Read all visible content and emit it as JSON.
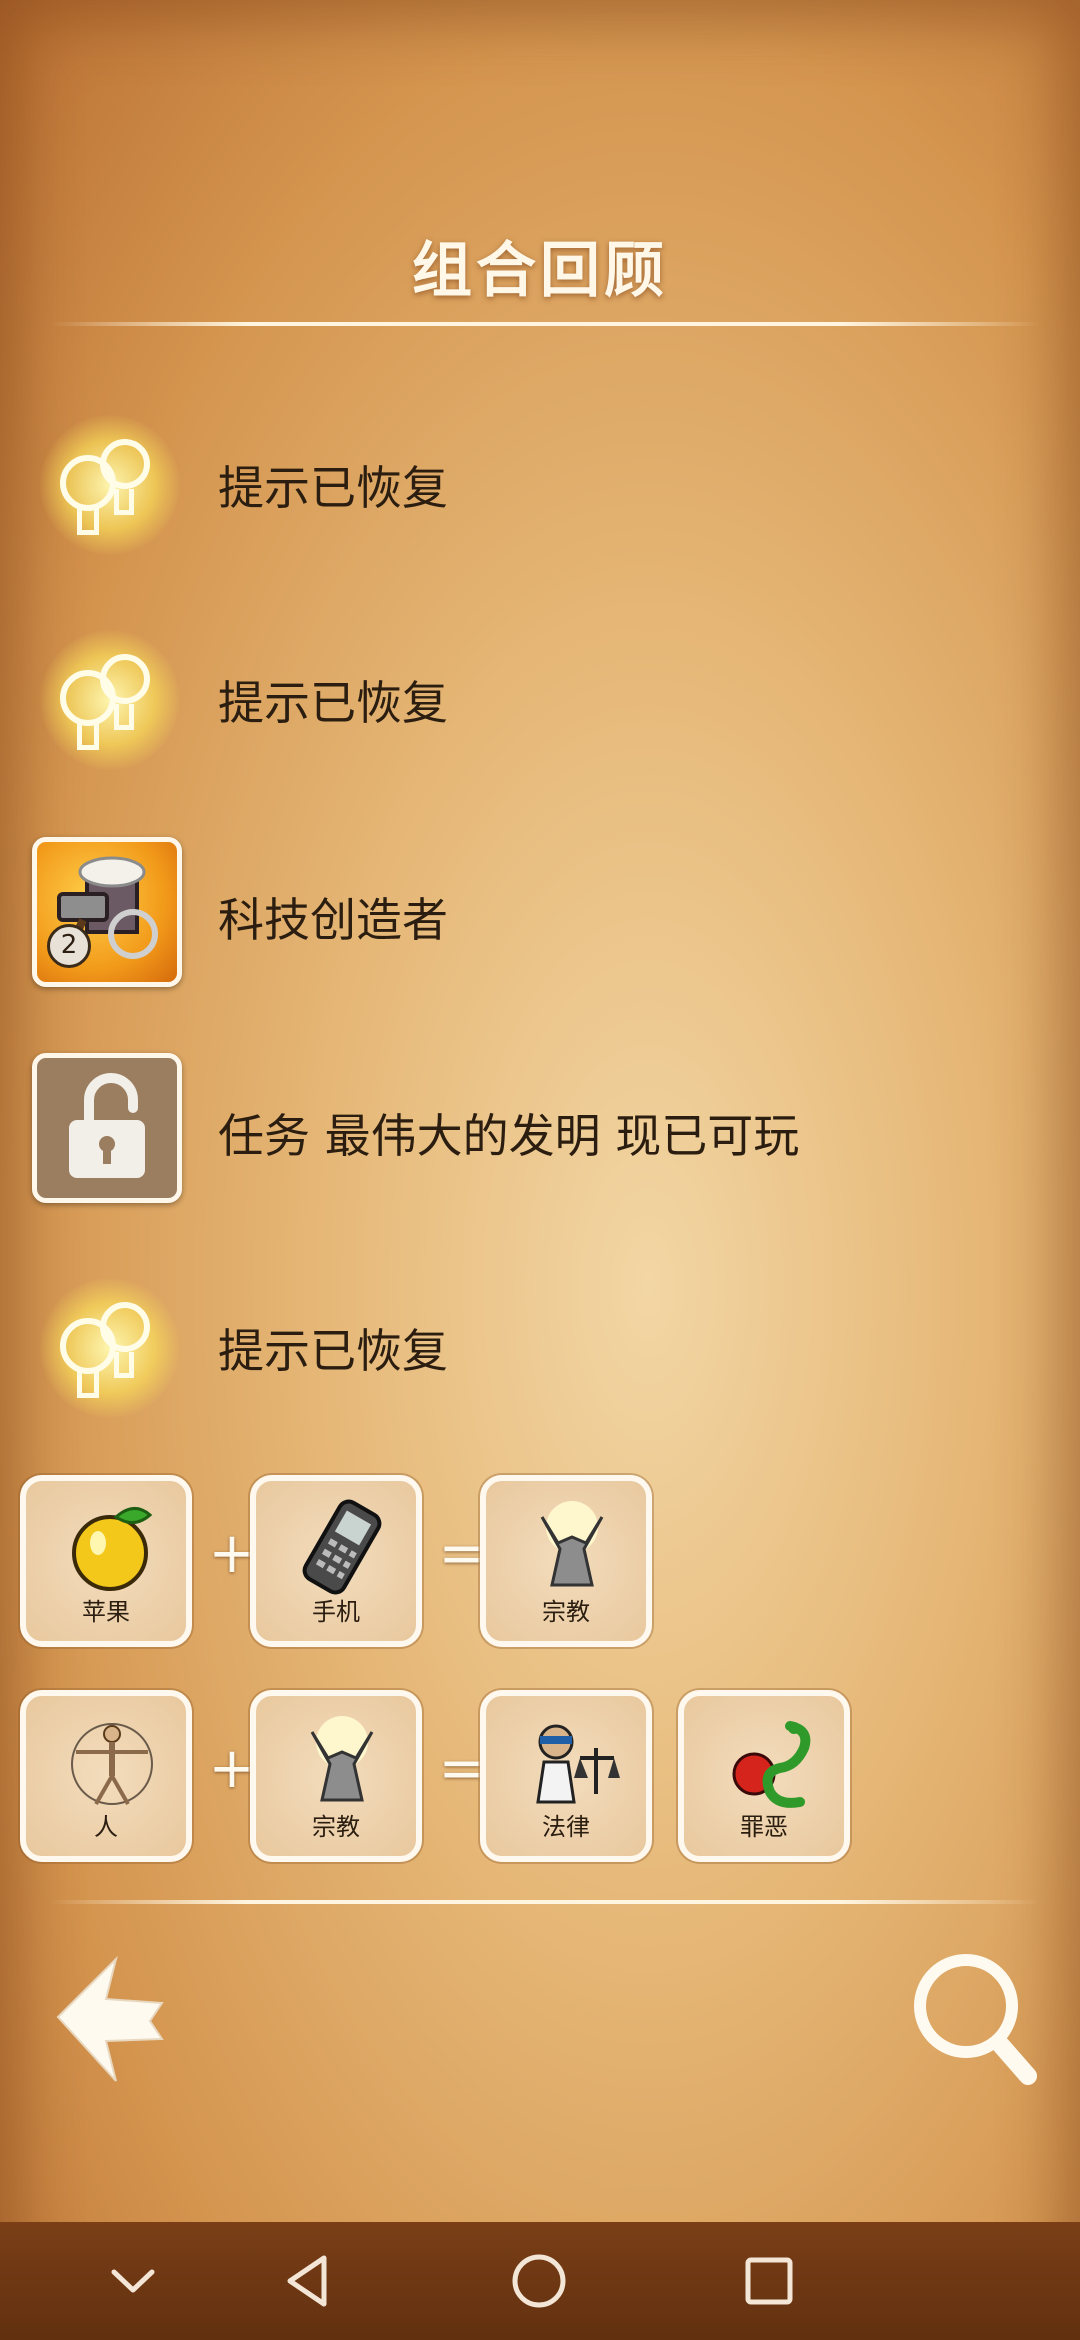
{
  "title": "组合回顾",
  "entries": [
    {
      "icon": "hint-bulb-icon",
      "label": "提示已恢复"
    },
    {
      "icon": "hint-bulb-icon",
      "label": "提示已恢复"
    },
    {
      "icon": "tech-creator-achievement-icon",
      "label": "科技创造者",
      "badge": "2"
    },
    {
      "icon": "unlock-padlock-icon",
      "label": "任务 最伟大的发明 现已可玩"
    },
    {
      "icon": "hint-bulb-icon",
      "label": "提示已恢复"
    }
  ],
  "combos": [
    {
      "items": [
        "苹果",
        "手机"
      ],
      "results": [
        "宗教"
      ]
    },
    {
      "items": [
        "人",
        "宗教"
      ],
      "results": [
        "法律",
        "罪恶"
      ]
    }
  ],
  "operators": {
    "plus": "+",
    "equals": "="
  },
  "colors": {
    "accent_text": "#fff8e8",
    "body_text": "#2b1e10",
    "system_bar": "#6a3512"
  }
}
